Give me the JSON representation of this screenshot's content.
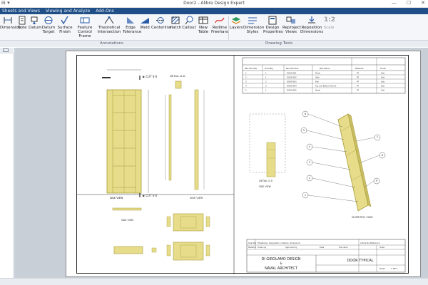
{
  "window": {
    "title": "Door2 - Alibre Design Expert",
    "minimize": "—",
    "maximize": "☐",
    "close": "✕",
    "quick_access": "⊟ ▾"
  },
  "tabs": [
    "Sheets and Views",
    "Viewing and Analyze",
    "Add-Ons"
  ],
  "ribbon": {
    "buttons": [
      {
        "label": "Dimension",
        "icon": "dimension-icon"
      },
      {
        "label": "Note",
        "icon": "note-icon"
      },
      {
        "label": "Datum",
        "icon": "datum-icon"
      },
      {
        "label": "Datum Target",
        "icon": "datum-target-icon"
      },
      {
        "label": "Surface Finish",
        "icon": "surface-finish-icon"
      },
      {
        "label": "Feature Control Frame",
        "icon": "feature-control-frame-icon"
      },
      {
        "label": "Theoretical Intersection",
        "icon": "theoretical-intersection-icon"
      },
      {
        "label": "Edge Tolerance",
        "icon": "edge-tolerance-icon"
      },
      {
        "label": "Weld",
        "icon": "weld-icon"
      },
      {
        "label": "Centerline",
        "icon": "centerline-icon"
      },
      {
        "label": "Hatch",
        "icon": "hatch-icon"
      },
      {
        "label": "Callout",
        "icon": "callout-icon"
      },
      {
        "label": "New Table",
        "icon": "new-table-icon"
      },
      {
        "label": "Redline Freehand",
        "icon": "redline-freehand-icon"
      },
      {
        "label": "Layers",
        "icon": "layers-icon"
      },
      {
        "label": "Dimension Styles",
        "icon": "dimension-styles-icon"
      },
      {
        "label": "Design Properties",
        "icon": "design-properties-icon"
      },
      {
        "label": "Reproject Views",
        "icon": "reproject-views-icon"
      },
      {
        "label": "Reposition Dimensions",
        "icon": "reposition-dimensions-icon"
      },
      {
        "label": "Scale",
        "icon": "scale-icon"
      }
    ],
    "groups": [
      "Annotations",
      "Drawing Tools"
    ],
    "scale_glyph": "1:2"
  },
  "drawing": {
    "view_labels": {
      "cut1": "CUT 0-0",
      "cut2": "CUT 0-0",
      "detail_top": "DETAIL D-D",
      "detail_bottom": "DETAIL 0-0"
    },
    "view_captions": [
      "SIDE VIEW",
      "SIDE VIEW",
      "SIDE VIEW",
      "ISOMETRIC VIEW"
    ],
    "balloons": [
      "6",
      "5",
      "4",
      "3",
      "2",
      "1",
      "7",
      "8",
      "9"
    ],
    "bom": {
      "headers": [
        "Item",
        "Part Number",
        "Quantity",
        "Part Number",
        "Part Name",
        "Material",
        "Finish"
      ],
      "rows": [
        [
          "1",
          "",
          "1",
          "DOOR-001",
          "Panel",
          "PF",
          "Oak"
        ],
        [
          "2",
          "",
          "1",
          "DOOR-002",
          "Stile",
          "PF",
          "Oak"
        ],
        [
          "3",
          "",
          "2",
          "DOOR-003",
          "Rail",
          "PF",
          "Oak"
        ],
        [
          "4",
          "",
          "2",
          "DOOR-004",
          "Top and Bottom Frame",
          "PF",
          "Oak"
        ],
        [
          "5",
          "",
          "1",
          "DOOR-005",
          "Panel",
          "PF",
          "Oak"
        ]
      ]
    },
    "title_block": {
      "company_line1": "DI GIROLAMO DESIGN",
      "amp": "&",
      "company_line2": "NAVAL ARCHITECT",
      "drawing_title": "DOOR TYPICAL",
      "cell_labels": [
        "Quantity",
        "Title/Name, designation, material, dimensions",
        "Article No./Reference",
        "Material",
        "Drawn by",
        "Approved by",
        "Date",
        "File name",
        "Scale",
        "Sheet",
        "1 OF 1"
      ],
      "sheet": "1 OF 1",
      "revision": "A"
    }
  },
  "colors": {
    "wood": "#e6dc8a",
    "wood_edge": "#a89b3c",
    "ribbon_bg": "#f4f6f9",
    "tab_blue": "#1f4f86"
  }
}
